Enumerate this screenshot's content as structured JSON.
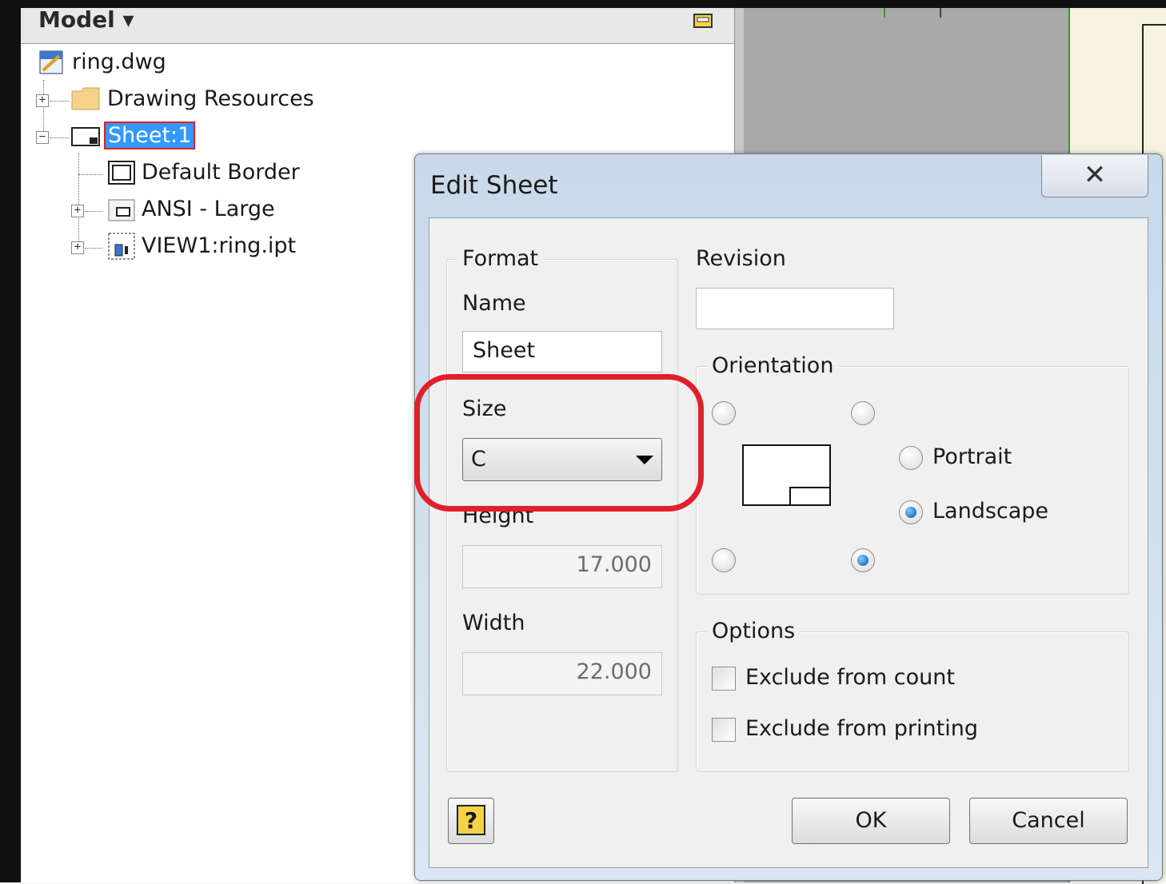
{
  "browser": {
    "title": "Model",
    "nodes": {
      "root": "ring.dwg",
      "resources": "Drawing Resources",
      "sheet": "Sheet:1",
      "border": "Default Border",
      "title_block": "ANSI - Large",
      "view": "VIEW1:ring.ipt"
    }
  },
  "dialog": {
    "title": "Edit Sheet",
    "close_glyph": "✕",
    "format": {
      "group_label": "Format",
      "name_label": "Name",
      "name_value": "Sheet",
      "size_label": "Size",
      "size_value": "C",
      "height_label": "Height",
      "height_value": "17.000",
      "width_label": "Width",
      "width_value": "22.000"
    },
    "revision": {
      "label": "Revision",
      "value": ""
    },
    "orientation": {
      "group_label": "Orientation",
      "portrait_label": "Portrait",
      "landscape_label": "Landscape",
      "selected": "Landscape",
      "title_block_corner_selected": "bottom-right"
    },
    "options": {
      "group_label": "Options",
      "exclude_count_label": "Exclude from count",
      "exclude_count_checked": false,
      "exclude_printing_label": "Exclude from printing",
      "exclude_printing_checked": false
    },
    "help_glyph": "?",
    "ok_label": "OK",
    "cancel_label": "Cancel"
  },
  "colors": {
    "selection": "#3399ff",
    "annotation_red": "#e0202a"
  }
}
